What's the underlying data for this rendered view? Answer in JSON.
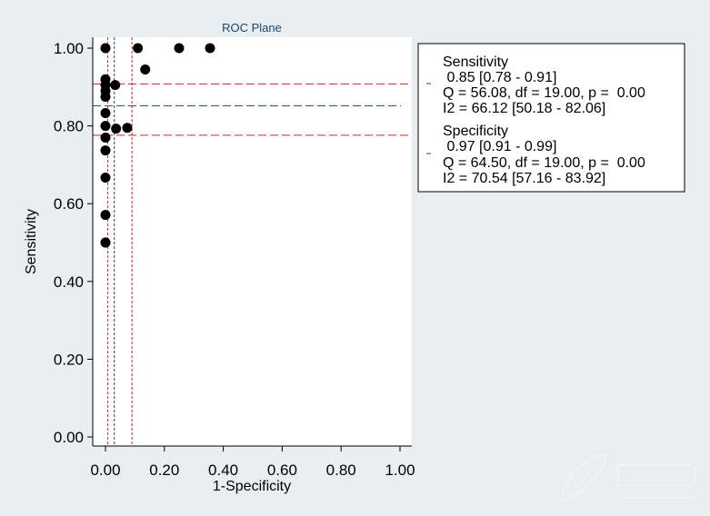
{
  "chart_data": {
    "type": "scatter",
    "title": "ROC Plane",
    "xlabel": "1-Specificity",
    "ylabel": "Sensitivity",
    "xlim": [
      0,
      1
    ],
    "ylim": [
      0,
      1
    ],
    "x_ticks": [
      "0.00",
      "0.20",
      "0.40",
      "0.60",
      "0.80",
      "1.00"
    ],
    "y_ticks": [
      "0.00",
      "0.20",
      "0.40",
      "0.60",
      "0.80",
      "1.00"
    ],
    "grid": false,
    "points": [
      {
        "x": 0.0,
        "y": 1.0
      },
      {
        "x": 0.11,
        "y": 1.0
      },
      {
        "x": 0.25,
        "y": 1.0
      },
      {
        "x": 0.355,
        "y": 1.0
      },
      {
        "x": 0.135,
        "y": 0.945
      },
      {
        "x": 0.0,
        "y": 0.92
      },
      {
        "x": 0.0,
        "y": 0.905
      },
      {
        "x": 0.033,
        "y": 0.905
      },
      {
        "x": 0.0,
        "y": 0.89
      },
      {
        "x": 0.0,
        "y": 0.875
      },
      {
        "x": 0.0,
        "y": 0.833
      },
      {
        "x": 0.0,
        "y": 0.8
      },
      {
        "x": 0.036,
        "y": 0.793
      },
      {
        "x": 0.074,
        "y": 0.795
      },
      {
        "x": 0.0,
        "y": 0.77
      },
      {
        "x": 0.0,
        "y": 0.737
      },
      {
        "x": 0.0,
        "y": 0.667
      },
      {
        "x": 0.0,
        "y": 0.571
      },
      {
        "x": 0.0,
        "y": 0.5
      },
      {
        "x": 0.0,
        "y": 0.5
      }
    ],
    "summary": {
      "sensitivity": 0.85,
      "sensitivity_ci": [
        0.78,
        0.91
      ],
      "specificity": 0.97,
      "specificity_ci": [
        0.91,
        0.99
      ]
    },
    "reference_lines": [
      {
        "orient": "h",
        "value": 0.908,
        "color": "#c1272d"
      },
      {
        "orient": "h",
        "value": 0.852,
        "color": "#1a476f"
      },
      {
        "orient": "h",
        "value": 0.776,
        "color": "#c1272d"
      },
      {
        "orient": "v",
        "value": 0.008,
        "color": "#c1272d"
      },
      {
        "orient": "v",
        "value": 0.03,
        "color": "#1a476f"
      },
      {
        "orient": "v",
        "value": 0.09,
        "color": "#c1272d"
      }
    ],
    "legend": {
      "placement": "right",
      "sections": [
        {
          "heading": "Sensitivity",
          "lines": [
            " 0.85 [0.78 - 0.91]",
            "Q = 56.08, df = 19.00, p =  0.00",
            "I2 = 66.12 [50.18 - 82.06]"
          ]
        },
        {
          "heading": "Specificity",
          "lines": [
            " 0.97 [0.91 - 0.99]",
            "Q = 64.50, df = 19.00, p =  0.00",
            "I2 = 70.54 [57.16 - 83.92]"
          ]
        }
      ]
    }
  },
  "colors": {
    "background": "#e9eef2",
    "plot_area": "#ffffff",
    "point": "#000000",
    "title": "#1a476f"
  }
}
